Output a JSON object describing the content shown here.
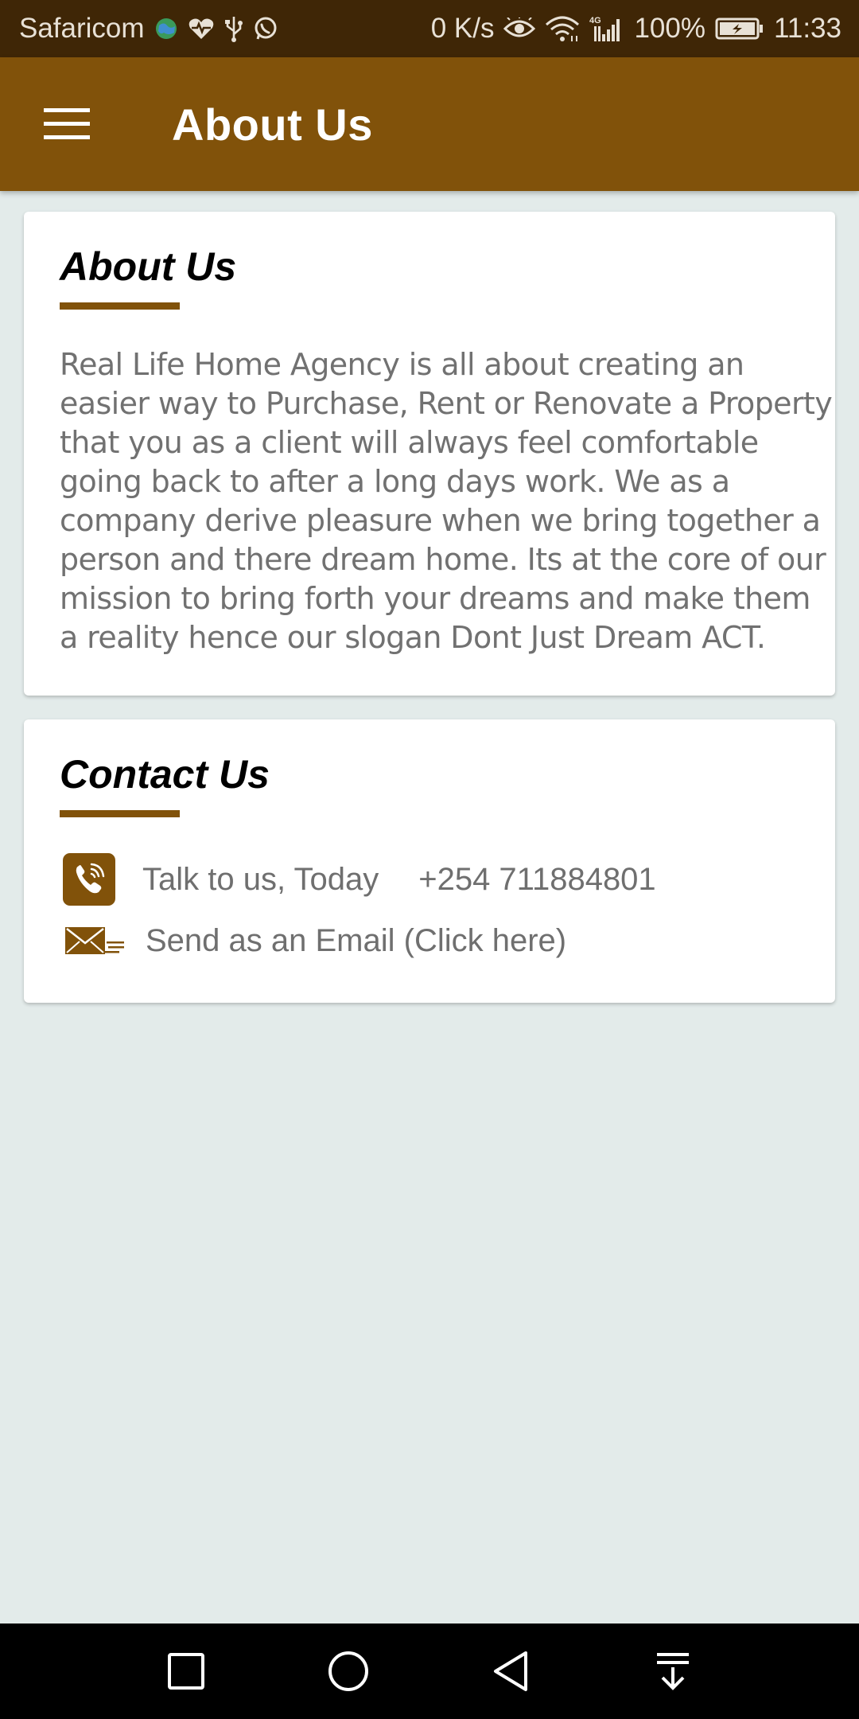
{
  "status_bar": {
    "carrier": "Safaricom",
    "speed": "0 K/s",
    "network": "4G",
    "battery": "100%",
    "time": "11:33",
    "icons": [
      "globe-icon",
      "heart-pulse-icon",
      "usb-icon",
      "whatsapp-icon",
      "eye-icon",
      "wifi-icon",
      "signal-icon",
      "battery-icon"
    ]
  },
  "app_bar": {
    "menu_icon": "hamburger-menu-icon",
    "title": "About Us"
  },
  "about": {
    "heading": "About Us",
    "paragraph_lines": [
      "Real Life Home Agency is all about creating an",
      "easier way to Purchase, Rent or Renovate a Property",
      "that you as a client will always feel comfortable",
      "going back to after a long days work. We as a",
      "company derive pleasure when we bring together a",
      "person and there dream home. Its at the core of our",
      "mission to bring forth your dreams and make them",
      "a reality hence our slogan Dont Just Dream ACT."
    ]
  },
  "contact": {
    "heading": "Contact Us",
    "phone_label": "Talk to us, Today",
    "phone_number": "+254 711884801",
    "email_label": "Send as an Email (Click here)",
    "phone_icon": "phone-icon",
    "email_icon": "envelope-icon"
  },
  "nav_bar": {
    "buttons": [
      "recent-apps-icon",
      "home-icon",
      "back-icon",
      "notification-pull-icon"
    ]
  },
  "colors": {
    "accent": "#81520a",
    "status_bar": "#3f2606",
    "background": "#e3ebea",
    "body_text": "#717171"
  }
}
